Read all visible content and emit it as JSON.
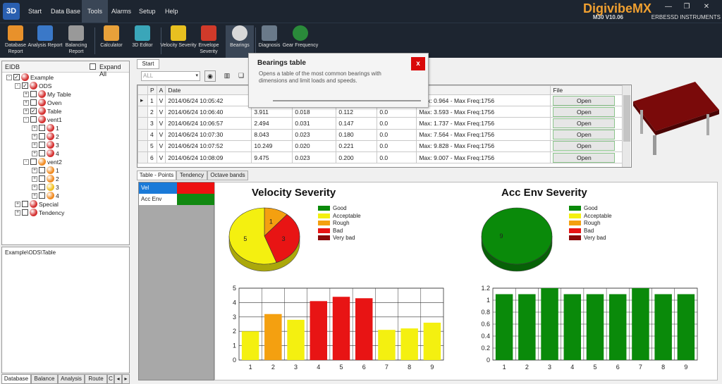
{
  "app": {
    "logo_text": "3D",
    "brand": "DigivibeMX",
    "version": "M30 V10.06",
    "company": "ERBESSD INSTRUMENTS"
  },
  "menu": [
    "Start",
    "Data Base",
    "Tools",
    "Alarms",
    "Setup",
    "Help"
  ],
  "ribbon": [
    {
      "label": "Database Report",
      "icon": "database-report-icon",
      "color": "#e8912b"
    },
    {
      "label": "Analysis Report",
      "icon": "analysis-report-icon",
      "color": "#3a78c8"
    },
    {
      "label": "Balancing Report",
      "icon": "balancing-report-icon",
      "color": "#999999"
    },
    {
      "label": "Calculator",
      "icon": "calculator-icon",
      "color": "#e8a13a"
    },
    {
      "label": "3D Editor",
      "icon": "3d-editor-icon",
      "color": "#3aa6b9"
    },
    {
      "label": "Velocity Severity",
      "icon": "iso-icon",
      "color": "#e8c020"
    },
    {
      "label": "Envelope Severity",
      "icon": "ge-icon",
      "color": "#d03a2a"
    },
    {
      "label": "Bearings",
      "icon": "bearing-icon",
      "color": "#d8d8d8"
    },
    {
      "label": "Diagnosis",
      "icon": "diagnosis-icon",
      "color": "#6a7a8a"
    },
    {
      "label": "Gear Frequency",
      "icon": "gear-icon",
      "color": "#2a8a3a"
    }
  ],
  "tooltip": {
    "title": "Bearings table",
    "text": "Opens a table of the most common bearings with dimensions and limit loads and speeds.",
    "close": "x"
  },
  "left_panel": {
    "title": "EIDB",
    "expand_all": "Expand All"
  },
  "tree": [
    {
      "label": "Example",
      "level": 0,
      "checked": true,
      "expander": "-",
      "ball": "#d43030"
    },
    {
      "label": "ODS",
      "level": 1,
      "checked": true,
      "expander": "-",
      "ball": "#d43030"
    },
    {
      "label": "My Table",
      "level": 2,
      "checked": false,
      "expander": "+",
      "ball": "#d43030"
    },
    {
      "label": "Oven",
      "level": 2,
      "checked": false,
      "expander": "+",
      "ball": "#d43030"
    },
    {
      "label": "Table",
      "level": 2,
      "checked": true,
      "expander": "+",
      "ball": "#d43030"
    },
    {
      "label": "vent1",
      "level": 2,
      "checked": false,
      "expander": "-",
      "ball": "#d43030"
    },
    {
      "label": "1",
      "level": 3,
      "checked": false,
      "expander": "+",
      "ball": "#d43030"
    },
    {
      "label": "2",
      "level": 3,
      "checked": false,
      "expander": "+",
      "ball": "#d43030"
    },
    {
      "label": "3",
      "level": 3,
      "checked": false,
      "expander": "+",
      "ball": "#d43030"
    },
    {
      "label": "4",
      "level": 3,
      "checked": false,
      "expander": "+",
      "ball": "#d43030"
    },
    {
      "label": "vent2",
      "level": 2,
      "checked": false,
      "expander": "-",
      "ball": "#f08a20"
    },
    {
      "label": "1",
      "level": 3,
      "checked": false,
      "expander": "+",
      "ball": "#f08a20"
    },
    {
      "label": "2",
      "level": 3,
      "checked": false,
      "expander": "+",
      "ball": "#f08a20"
    },
    {
      "label": "3",
      "level": 3,
      "checked": false,
      "expander": "+",
      "ball": "#f0c020"
    },
    {
      "label": "4",
      "level": 3,
      "checked": false,
      "expander": "+",
      "ball": "#f08a20"
    },
    {
      "label": "Special",
      "level": 1,
      "checked": false,
      "expander": "+",
      "ball": "#d43030"
    },
    {
      "label": "Tendency",
      "level": 1,
      "checked": false,
      "expander": "+",
      "ball": "#d43030"
    }
  ],
  "path": "Example\\ODS\\Table",
  "bottom_tabs": [
    "Database",
    "Balance",
    "Analysis",
    "Route",
    "C"
  ],
  "main_tab": "Start",
  "filter": {
    "value": "ALL"
  },
  "table": {
    "columns": [
      "",
      "P",
      "A",
      "Date",
      "",
      "",
      "",
      "",
      "tra",
      "File"
    ],
    "rows": [
      {
        "p": "1",
        "a": "V",
        "date": "2014/06/24 10:05:42",
        "v1": "",
        "v2": "",
        "v3": "",
        "v4": "",
        "extra": "Max: 0.964 - Max Freq:1756",
        "file": "Open"
      },
      {
        "p": "2",
        "a": "V",
        "date": "2014/06/24 10:06:40",
        "v1": "3.911",
        "v2": "0.018",
        "v3": "0.112",
        "v4": "0.0",
        "extra": "Max: 3.593 - Max Freq:1756",
        "file": "Open"
      },
      {
        "p": "3",
        "a": "V",
        "date": "2014/06/24 10:06:57",
        "v1": "2.494",
        "v2": "0.031",
        "v3": "0.147",
        "v4": "0.0",
        "extra": "Max: 1.737 - Max Freq:1756",
        "file": "Open"
      },
      {
        "p": "4",
        "a": "V",
        "date": "2014/06/24 10:07:30",
        "v1": "8.043",
        "v2": "0.023",
        "v3": "0.180",
        "v4": "0.0",
        "extra": "Max: 7.564 - Max Freq:1756",
        "file": "Open"
      },
      {
        "p": "5",
        "a": "V",
        "date": "2014/06/24 10:07:52",
        "v1": "10.249",
        "v2": "0.020",
        "v3": "0.221",
        "v4": "0.0",
        "extra": "Max: 9.828 - Max Freq:1756",
        "file": "Open"
      },
      {
        "p": "6",
        "a": "V",
        "date": "2014/06/24 10:08:09",
        "v1": "9.475",
        "v2": "0.023",
        "v3": "0.200",
        "v4": "0.0",
        "extra": "Max: 9.007 - Max Freq:1756",
        "file": "Open"
      }
    ]
  },
  "sub_tabs": [
    "Table - Points",
    "Tendency",
    "Octave bands"
  ],
  "series_legend": [
    {
      "name": "Vel",
      "color": "#ee1111",
      "name_bg": "#1a7ad8"
    },
    {
      "name": "Acc Env",
      "color": "#118811",
      "name_bg": "#ffffff"
    }
  ],
  "severity_legend": [
    {
      "label": "Good",
      "color": "#0a8a0a"
    },
    {
      "label": "Acceptable",
      "color": "#f4f010"
    },
    {
      "label": "Rough",
      "color": "#f4a010"
    },
    {
      "label": "Bad",
      "color": "#e81414"
    },
    {
      "label": "Very bad",
      "color": "#8a0a0a"
    }
  ],
  "chart_data": [
    {
      "type": "pie",
      "title": "Velocity Severity",
      "slices": [
        {
          "label": "Rough",
          "value": 1,
          "color": "#f4a010"
        },
        {
          "label": "Bad",
          "value": 3,
          "color": "#e81414"
        },
        {
          "label": "Acceptable",
          "value": 5,
          "color": "#f4f010"
        }
      ]
    },
    {
      "type": "pie",
      "title": "Acc Env Severity",
      "slices": [
        {
          "label": "Good",
          "value": 9,
          "color": "#0a8a0a"
        }
      ]
    },
    {
      "type": "bar",
      "title": "",
      "categories": [
        "1",
        "2",
        "3",
        "4",
        "5",
        "6",
        "7",
        "8",
        "9"
      ],
      "values": [
        2.0,
        3.2,
        2.8,
        4.1,
        4.4,
        4.3,
        2.1,
        2.2,
        2.6
      ],
      "colors": [
        "#f4f010",
        "#f4a010",
        "#f4f010",
        "#e81414",
        "#e81414",
        "#e81414",
        "#f4f010",
        "#f4f010",
        "#f4f010"
      ],
      "ylim": [
        0,
        5
      ],
      "yticks": [
        "0",
        "1",
        "2",
        "3",
        "4",
        "5"
      ]
    },
    {
      "type": "bar",
      "title": "",
      "categories": [
        "1",
        "2",
        "3",
        "4",
        "5",
        "6",
        "7",
        "8",
        "9"
      ],
      "values": [
        1.1,
        1.1,
        1.2,
        1.1,
        1.1,
        1.1,
        1.2,
        1.1,
        1.1
      ],
      "colors": [
        "#0a8a0a",
        "#0a8a0a",
        "#0a8a0a",
        "#0a8a0a",
        "#0a8a0a",
        "#0a8a0a",
        "#0a8a0a",
        "#0a8a0a",
        "#0a8a0a"
      ],
      "ylim": [
        0,
        1.2
      ],
      "yticks": [
        "0",
        "0.2",
        "0.4",
        "0.6",
        "0.8",
        "1",
        "1.2"
      ]
    }
  ]
}
